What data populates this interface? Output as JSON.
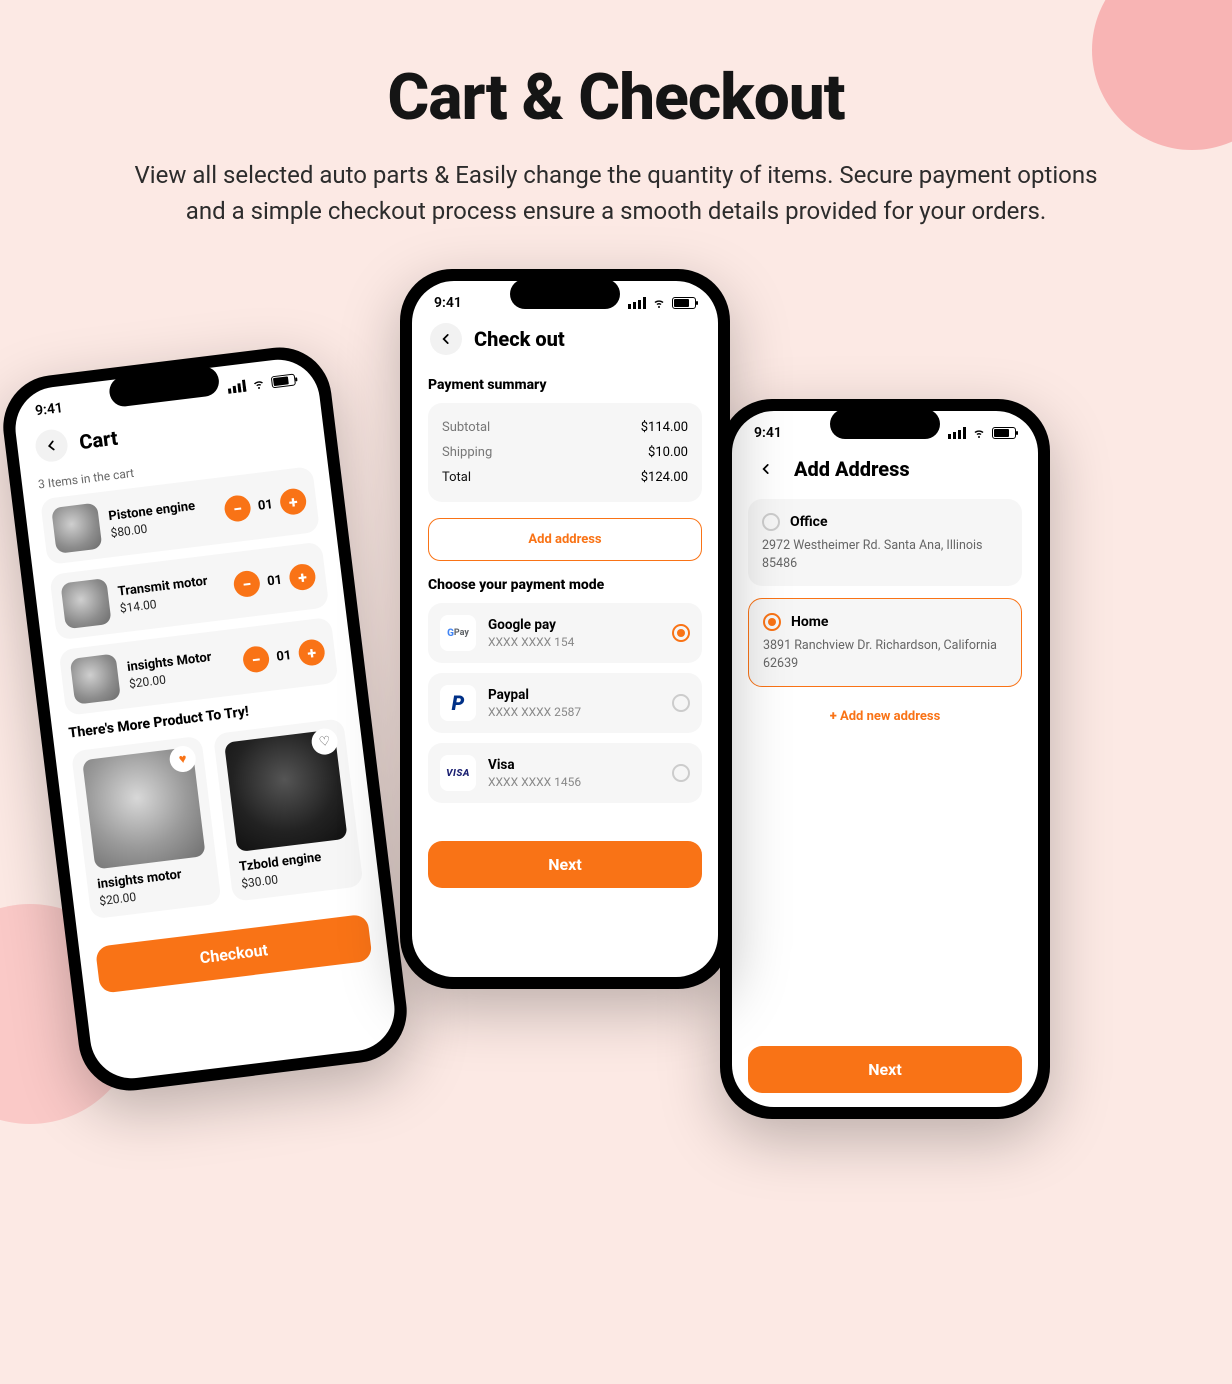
{
  "hero": {
    "title": "Cart & Checkout",
    "subtitle": "View all selected auto parts & Easily change the quantity of items. Secure payment options and a simple checkout process ensure a smooth details provided for your orders."
  },
  "status_time": "9:41",
  "cart": {
    "title": "Cart",
    "count_label": "3 Items in the cart",
    "items": [
      {
        "name": "Pistone engine",
        "price": "$80.00",
        "qty": "01"
      },
      {
        "name": "Transmit motor",
        "price": "$14.00",
        "qty": "01"
      },
      {
        "name": "insights Motor",
        "price": "$20.00",
        "qty": "01"
      }
    ],
    "more_title": "There's  More Product To Try!",
    "more": [
      {
        "name": "insights motor",
        "price": "$20.00",
        "fav": true
      },
      {
        "name": "Tzbold engine",
        "price": "$30.00",
        "fav": false
      }
    ],
    "cta": "Checkout"
  },
  "checkout": {
    "title": "Check out",
    "summary_title": "Payment summary",
    "rows": {
      "subtotal_l": "Subtotal",
      "subtotal_v": "$114.00",
      "shipping_l": "Shipping",
      "shipping_v": "$10.00",
      "total_l": "Total",
      "total_v": "$124.00"
    },
    "add_address": "Add address",
    "mode_title": "Choose your payment mode",
    "methods": [
      {
        "name": "Google pay",
        "mask": "XXXX XXXX 154",
        "selected": true,
        "logo": "gpay"
      },
      {
        "name": "Paypal",
        "mask": "XXXX XXXX 2587",
        "selected": false,
        "logo": "paypal"
      },
      {
        "name": "Visa",
        "mask": "XXXX XXXX 1456",
        "selected": false,
        "logo": "visa"
      }
    ],
    "cta": "Next"
  },
  "address": {
    "title": "Add Address",
    "items": [
      {
        "name": "Office",
        "addr": "2972 Westheimer Rd. Santa Ana, Illinois 85486",
        "selected": false
      },
      {
        "name": "Home",
        "addr": "3891 Ranchview Dr. Richardson, California 62639",
        "selected": true
      }
    ],
    "add_new": "Add new address",
    "cta": "Next"
  }
}
